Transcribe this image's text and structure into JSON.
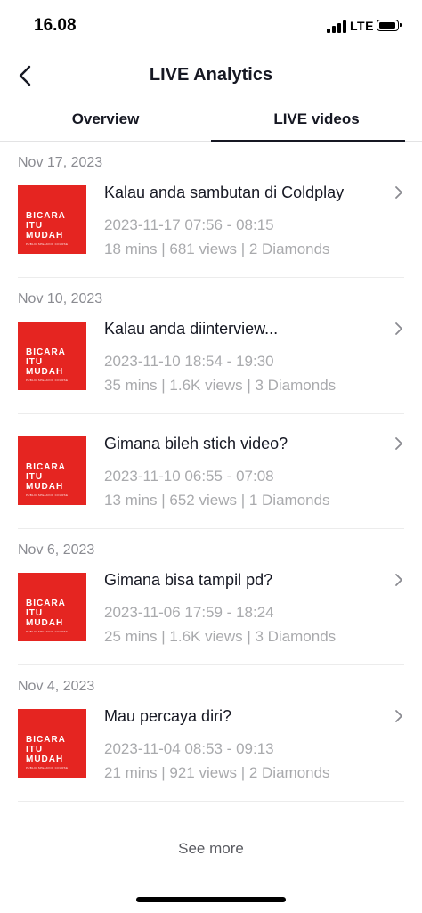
{
  "status_bar": {
    "time": "16.08",
    "network": "LTE",
    "icons": [
      "signal-icon",
      "battery-icon"
    ]
  },
  "header": {
    "title": "LIVE Analytics",
    "back_icon": "back-arrow-icon"
  },
  "tabs": [
    {
      "label": "Overview",
      "active": false
    },
    {
      "label": "LIVE videos",
      "active": true
    }
  ],
  "groups": [
    {
      "date": "Nov 17, 2023",
      "items": [
        {
          "title": "Kalau anda sambutan di Coldplay",
          "time_range": "2023-11-17 07:56 - 08:15",
          "stats": "18 mins | 681 views | 2 Diamonds",
          "thumb_text": "BICARA\nITU\nMUDAH",
          "thumb_sub": "PUBLIC SPEAKING COURSE"
        }
      ]
    },
    {
      "date": "Nov 10, 2023",
      "items": [
        {
          "title": "Kalau anda diinterview...",
          "time_range": "2023-11-10 18:54 - 19:30",
          "stats": "35 mins | 1.6K views | 3 Diamonds",
          "thumb_text": "BICARA\nITU\nMUDAH",
          "thumb_sub": "PUBLIC SPEAKING COURSE"
        },
        {
          "title": "Gimana bileh stich video?",
          "time_range": "2023-11-10 06:55 - 07:08",
          "stats": "13 mins | 652 views | 1 Diamonds",
          "thumb_text": "BICARA\nITU\nMUDAH",
          "thumb_sub": "PUBLIC SPEAKING COURSE"
        }
      ]
    },
    {
      "date": "Nov 6, 2023",
      "items": [
        {
          "title": "Gimana bisa tampil pd?",
          "time_range": "2023-11-06 17:59 - 18:24",
          "stats": "25 mins | 1.6K views | 3 Diamonds",
          "thumb_text": "BICARA\nITU\nMUDAH",
          "thumb_sub": "PUBLIC SPEAKING COURSE"
        }
      ]
    },
    {
      "date": "Nov 4, 2023",
      "items": [
        {
          "title": "Mau percaya diri?",
          "time_range": "2023-11-04 08:53 - 09:13",
          "stats": "21 mins | 921 views | 2 Diamonds",
          "thumb_text": "BICARA\nITU\nMUDAH",
          "thumb_sub": "PUBLIC SPEAKING COURSE"
        }
      ]
    }
  ],
  "see_more_label": "See more",
  "colors": {
    "thumbnail_red": "#e52521",
    "text_primary": "#161823",
    "text_secondary": "#a9aaad",
    "date_header": "#8a8b91"
  }
}
